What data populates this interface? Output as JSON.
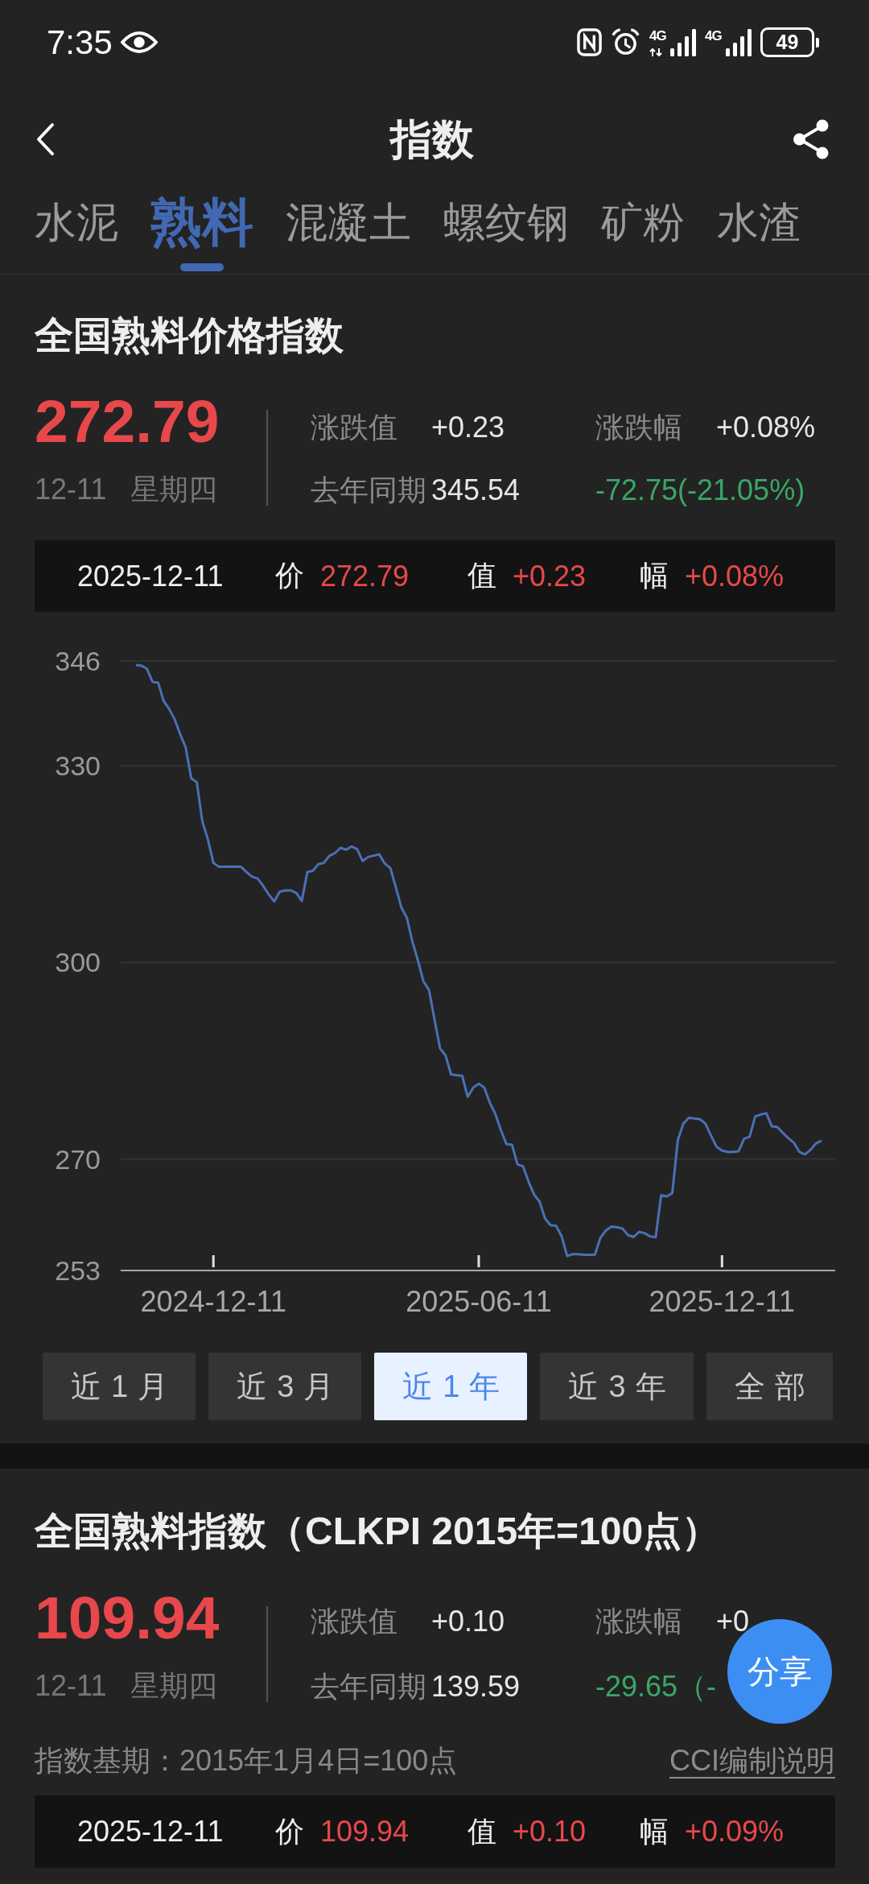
{
  "status_bar": {
    "time": "7:35",
    "signals": [
      {
        "network": "4G",
        "data_active": true
      },
      {
        "network": "4G",
        "data_active": false
      }
    ],
    "battery": "49"
  },
  "header": {
    "title": "指数"
  },
  "tabs": [
    {
      "label": "水泥",
      "selected": false
    },
    {
      "label": "熟料",
      "selected": true
    },
    {
      "label": "混凝土",
      "selected": false
    },
    {
      "label": "螺纹钢",
      "selected": false
    },
    {
      "label": "矿粉",
      "selected": false
    },
    {
      "label": "水渣",
      "selected": false
    }
  ],
  "cards": [
    {
      "title": "全国熟料价格指数",
      "price": "272.79",
      "rising": true,
      "date": "12-11",
      "weekday": "星期四",
      "stats": [
        {
          "label": "涨跌值",
          "value": "+0.23"
        },
        {
          "label": "涨跌幅",
          "value": "+0.08%"
        },
        {
          "label": "去年同期",
          "value": "345.54"
        }
      ],
      "yoy_change": {
        "text": "-72.75(-21.05%)",
        "rising": false
      },
      "daily_bar": {
        "date": "2025-12-11",
        "price_label": "价",
        "price": "272.79",
        "change_label": "值",
        "change": "+0.23",
        "pct_label": "幅",
        "pct": "+0.08%"
      },
      "chart_data": {
        "type": "line",
        "grid": true,
        "ylim": [
          253,
          346
        ],
        "yticks": [
          253,
          270,
          300,
          330,
          346
        ],
        "categories": [
          null,
          null,
          null,
          null,
          null,
          null,
          null,
          null,
          null,
          null,
          null,
          null,
          null,
          null,
          "2024-12-11",
          null,
          null,
          null,
          null,
          null,
          null,
          null,
          null,
          null,
          null,
          null,
          null,
          null,
          null,
          null,
          null,
          null,
          null,
          null,
          null,
          null,
          null,
          null,
          null,
          null,
          null,
          null,
          null,
          null,
          null,
          null,
          null,
          null,
          null,
          null,
          null,
          null,
          null,
          null,
          null,
          null,
          null,
          null,
          null,
          null,
          null,
          null,
          "2025-06-11",
          null,
          null,
          null,
          null,
          null,
          null,
          null,
          null,
          null,
          null,
          null,
          null,
          null,
          null,
          null,
          null,
          null,
          null,
          null,
          null,
          null,
          null,
          null,
          null,
          null,
          null,
          null,
          null,
          null,
          null,
          null,
          null,
          null,
          null,
          null,
          null,
          null,
          null,
          null,
          null,
          null,
          null,
          null,
          "2025-12-11",
          null,
          null,
          null,
          null,
          null,
          null,
          null,
          null,
          null,
          null,
          null,
          null,
          null,
          null,
          null,
          null,
          null,
          null
        ],
        "values": [
          345.4,
          345.3,
          344.8,
          342.8,
          342.7,
          339.9,
          338.7,
          337.1,
          334.8,
          332.8,
          328.1,
          327.5,
          321.5,
          318.8,
          315.2,
          314.6,
          314.6,
          314.6,
          314.6,
          314.6,
          313.8,
          313.1,
          312.8,
          311.7,
          310.4,
          309.3,
          310.8,
          311.0,
          311.0,
          310.6,
          309.4,
          313.8,
          314.0,
          315.0,
          315.2,
          316.3,
          316.7,
          317.5,
          317.2,
          317.7,
          317.3,
          315.5,
          316.1,
          316.3,
          316.5,
          315.1,
          314.4,
          311.5,
          308.4,
          306.8,
          303.2,
          300.3,
          297.1,
          295.8,
          291.3,
          286.9,
          285.8,
          282.9,
          282.8,
          282.7,
          279.5,
          280.9,
          281.5,
          280.9,
          278.6,
          276.9,
          274.4,
          272.3,
          272.2,
          269.2,
          268.9,
          266.6,
          264.6,
          263.5,
          260.9,
          259.9,
          259.8,
          258.2,
          255.2,
          255.5,
          255.5,
          255.4,
          255.4,
          255.4,
          258.0,
          259.1,
          259.7,
          259.6,
          259.4,
          258.4,
          258.1,
          258.9,
          258.7,
          258.2,
          258.1,
          264.5,
          264.3,
          264.8,
          272.9,
          275.4,
          276.3,
          276.2,
          276.1,
          275.4,
          273.6,
          271.9,
          271.3,
          271.1,
          271.1,
          271.2,
          273.1,
          273.4,
          276.5,
          276.8,
          277.0,
          275.0,
          274.9,
          274.0,
          273.2,
          272.5,
          271.1,
          270.7,
          271.4,
          272.4,
          272.8
        ]
      },
      "ranges": [
        {
          "label": "近1月",
          "selected": false
        },
        {
          "label": "近3月",
          "selected": false
        },
        {
          "label": "近1年",
          "selected": true
        },
        {
          "label": "近3年",
          "selected": false
        },
        {
          "label": "全部",
          "selected": false
        }
      ]
    },
    {
      "title": "全国熟料指数（CLKPI 2015年=100点）",
      "price": "109.94",
      "rising": true,
      "date": "12-11",
      "weekday": "星期四",
      "stats": [
        {
          "label": "涨跌值",
          "value": "+0.10"
        },
        {
          "label": "涨跌幅",
          "value": "+0"
        },
        {
          "label": "去年同期",
          "value": "139.59"
        }
      ],
      "yoy_change": {
        "text": "-29.65（-",
        "rising": false
      },
      "base_note": "指数基期：2015年1月4日=100点",
      "link": "CCI编制说明",
      "daily_bar": {
        "date": "2025-12-11",
        "price_label": "价",
        "price": "109.94",
        "change_label": "值",
        "change": "+0.10",
        "pct_label": "幅",
        "pct": "+0.09%"
      }
    }
  ],
  "share_button": {
    "label": "分享"
  }
}
